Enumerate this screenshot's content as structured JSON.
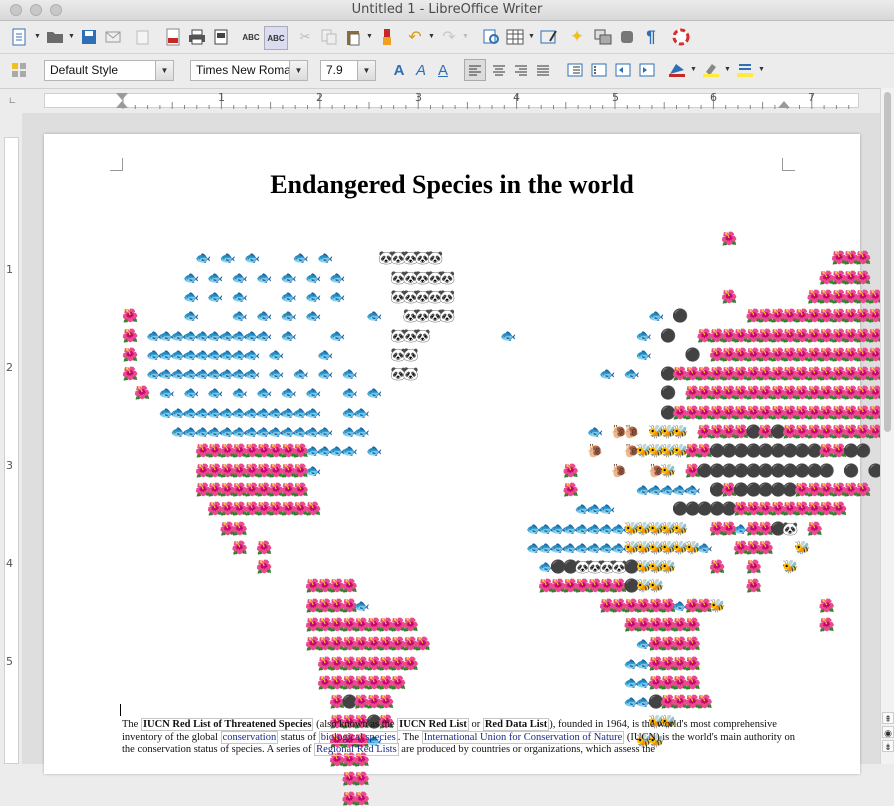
{
  "window": {
    "title": "Untitled 1 - LibreOffice Writer"
  },
  "toolbar": {
    "paragraph_style": "Default Style",
    "font_name": "Times New Roma",
    "font_size": "7.9"
  },
  "ruler": {
    "h_numbers": [
      "1",
      "2",
      "3",
      "4",
      "5",
      "6",
      "7"
    ],
    "v_numbers": [
      "1",
      "2",
      "3",
      "4",
      "5"
    ]
  },
  "document": {
    "title": "Endangered Species in the world",
    "paragraph": {
      "t1": "The ",
      "b1": "IUCN Red List of Threatened Species",
      "t2": " (also known as the ",
      "b2": "IUCN Red List",
      "t3": " or ",
      "b3": "Red Data List",
      "t4": "), founded in 1964, is the world's most comprehensive inventory of the global ",
      "l1": "conservation",
      "t5": " status of ",
      "l2": "biological species",
      "t6": ". The ",
      "l3": "International Union for Conservation of Nature",
      "t7": " (IUCN) is the world's main authority on the conservation status of species. A series of ",
      "l4": "Regional Red Lists",
      "t8": " are produced by countries or organizations, which assess the"
    }
  },
  "map": {
    "legend_icons": {
      "F": "fish-icon",
      "R": "flower-icon",
      "P": "panda-icon",
      "S": "stone-icon",
      "B": "bee-icon",
      "N": "snail-icon"
    },
    "glyphs": {
      "F": "🐟",
      "R": "🌺",
      "P": "🐼",
      "S": "⚫",
      "B": "🐝",
      "N": "🐌"
    },
    "rows": [
      [
        "                        ",
        "                          R                  "
      ],
      [
        "      F F F   F F    PPPPP",
        "                                   RRR       "
      ],
      [
        "     F F F F F F F    PPPPP",
        "                                  RRRR       "
      ],
      [
        "     F F F   F F F    PPPPP",
        "                          R      RRRRRRR     "
      ],
      [
        "R    F   F F F F    F  PPPP",
        "                    F S     RRRRRRRRRRRRRR   "
      ],
      [
        "R FFFFFFFFFF F   F    PPP      F",
        "                   F S  RRRRRRRRRRRRRRRR    "
      ],
      [
        "R FFFFFFFFF F   F     PP   ",
        "                   F   S RRRRRRRRRRRRRRRRRR  "
      ],
      [
        "R FFFFFFFFF F F F F   PP   ",
        "                F F  SRRRRRRRRRRRRRRRRRR     "
      ],
      [
        " R F F F F F F F  F F      ",
        "                     S RRRRRRRRRRRRRRRRRR    "
      ],
      [
        "   FFFFFFFFFFFFF  FF       ",
        "                     SRRRRRRRRRRRRRRRRRRR    "
      ],
      [
        "    FFFFFFFFFFFFF FF       ",
        "               F NN BBB RRRRSRSRRRRRRRRRR    "
      ],
      [
        "      RRRRRRRRRFFFF F       ",
        "               N  NBBBBRRSSSSSSSSSRRSS      "
      ],
      [
        "      RRRRRRRRRF            ",
        "             R   N  NB RSSSSSSSSSSS S S      "
      ],
      [
        "      RRRRRRRRR             ",
        "             R     FFFFF SRSSSSSRRRRRR       "
      ],
      [
        "       RRRRRRRRR            ",
        "              FFF     SSSSSRRRRRRRRR        "
      ],
      [
        "        RR                  ",
        "          FFFFFFFFBBBBB  RRFRRSP R          "
      ],
      [
        "         R R                ",
        "          FFFFFFFFBBBBBBF  RRR  B           "
      ],
      [
        "           R                ",
        "           FSSPPPPSBBB   R  R  B            "
      ],
      [
        "               RRRR          ",
        "           RRRRRRRSBB       R               "
      ],
      [
        "               RRRRF         ",
        "                RRRRRRFRRB        R         "
      ],
      [
        "               RRRRRRRRR     ",
        "                  RRRRRR          R         "
      ],
      [
        "               RRRRRRRRRR    ",
        "                   FRRRR                    "
      ],
      [
        "                RRRRRRRR     ",
        "                  FFRRRR                    "
      ],
      [
        "                RRRRRRR      ",
        "                  FFRRRR                    "
      ],
      [
        "                 RSRRR       ",
        "                  FFSRRRR                   "
      ],
      [
        "                 RRRSR       ",
        "                    BB                      "
      ],
      [
        "                 RRRF        ",
        "                   BB                       "
      ],
      [
        "                 RRR         ",
        "                                            "
      ],
      [
        "                  RR         ",
        "                                            "
      ],
      [
        "                  RR         ",
        "                                            "
      ]
    ]
  }
}
